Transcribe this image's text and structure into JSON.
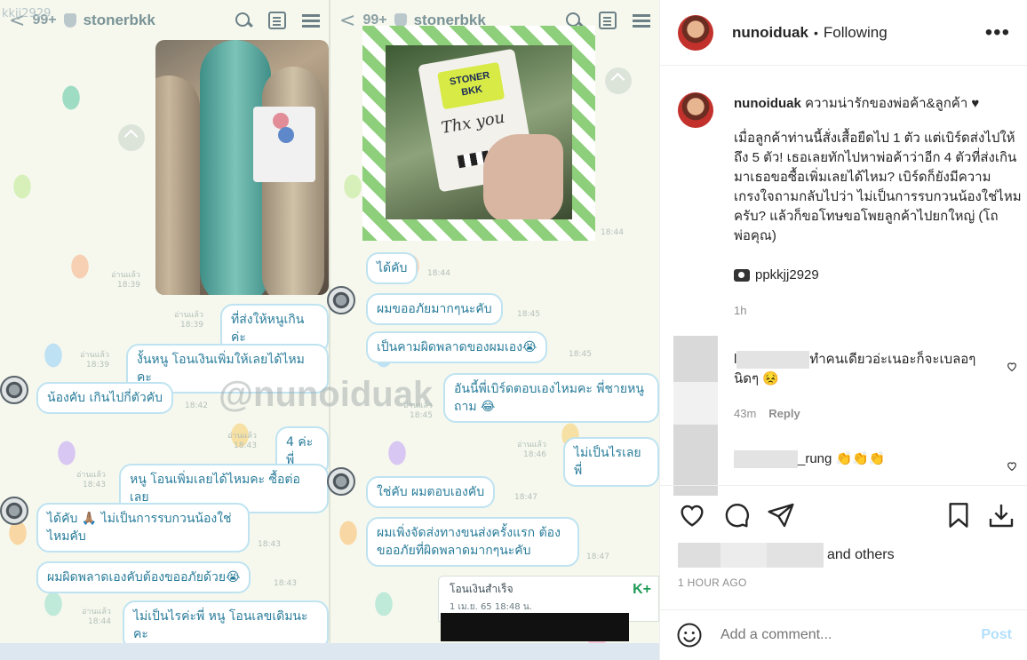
{
  "chat_left": {
    "back_count": "99+",
    "chat_name": "stonerbkk",
    "overlay_user": "kkjj2929",
    "messages": [
      {
        "text": "ที่ส่งให้หนูเกินค่ะ",
        "meta": "อ่านแล้ว\n18:39"
      },
      {
        "text": "งั้นหนู โอนเงินเพิ่มให้เลยได้ไหมคะ",
        "meta": "อ่านแล้ว\n18:39"
      },
      {
        "text": "น้องคับ เกินไปกี่ตัวคับ",
        "meta": "18:42"
      },
      {
        "text": "4 ค่ะพี่",
        "meta": "อ่านแล้ว\n18:43"
      },
      {
        "text": "หนู โอนเพิ่มเลยได้ไหมคะ ซื้อต่อเลย",
        "meta": "อ่านแล้ว\n18:43"
      },
      {
        "text": "ได้คับ 🙏🏽 ไม่เป็นการรบกวนน้องใช่ไหมคับ",
        "meta": "18:43"
      },
      {
        "text": "ผมผิดพลาดเองคับต้องขออภัยด้วย😭",
        "meta": "18:43"
      },
      {
        "text": "ไม่เป็นไรค่ะพี่ หนู โอนเลขเดิมนะคะ",
        "meta": "อ่านแล้ว\n18:44"
      }
    ],
    "photo_meta": "อ่านแล้ว\n18:39"
  },
  "chat_right": {
    "back_count": "99+",
    "chat_name": "stonerbkk",
    "sticker_text": "STONER BKK",
    "sign_text": "Thx you",
    "photo_meta": "18:44",
    "messages": [
      {
        "text": "ได้คับ",
        "meta": "18:44"
      },
      {
        "text": "ผมขออภัยมากๆนะคับ",
        "meta": "18:45"
      },
      {
        "text": "เป็นคามผิดพลาดของผมเอง😭",
        "meta": "18:45"
      },
      {
        "text": "อันนี้พี่เบิร์ดตอบเองไหมคะ พี่ชายหนูถาม 😂",
        "meta": "อ่านแล้ว\n18:45"
      },
      {
        "text": "ไม่เป็นไรเลยพี่",
        "meta": "อ่านแล้ว\n18:46"
      },
      {
        "text": "ใช่คับ ผมตอบเองคับ",
        "meta": "18:47"
      },
      {
        "text": "ผมเพิ่งจัดส่งทางขนส่งครั้งแรก ต้องขออภัยที่ผิดพลาดมากๆนะคับ",
        "meta": "18:47"
      }
    ],
    "transfer": {
      "title": "โอนเงินสำเร็จ",
      "date": "1 เม.ย. 65  18:48 น.",
      "bank": "K+"
    }
  },
  "watermark": "@nunoiduak",
  "post": {
    "username": "nunoiduak",
    "separator": "•",
    "follow_state": "Following",
    "more": "•••",
    "caption_title": "ความน่ารักของพ่อค้า&ลูกค้า ♥",
    "caption_body": "เมื่อลูกค้าท่านนี้สั่งเสื้อยืดไป 1 ตัว แต่เบิร์ดส่งไปให้ถึง 5 ตัว! เธอเลยทักไปหาพ่อค้าว่าอีก 4 ตัวที่ส่งเกินมาเธอขอซื้อเพิ่มเลยได้ไหม? เบิร์ดก็ยังมีความเกรงใจถามกลับไปว่า ไม่เป็นการรบกวนน้องใช่ไหมครับ? แล้วก็ขอโทษขอโพยลูกค้าไปยกใหญ่ (โถพ่อคุณ)",
    "credit": "ppkkjj2929",
    "caption_time": "1h",
    "comments": [
      {
        "prefix": "l",
        "text": "ทำคนเดียวอ่ะเนอะก็จะเบลอๆ นิดๆ 😣",
        "time": "43m",
        "reply": "Reply"
      },
      {
        "suffix": "_rung",
        "text": "👏👏👏"
      }
    ],
    "likes_suffix": "and others",
    "ago": "1 HOUR AGO",
    "comment_placeholder": "Add a comment...",
    "post_label": "Post"
  }
}
